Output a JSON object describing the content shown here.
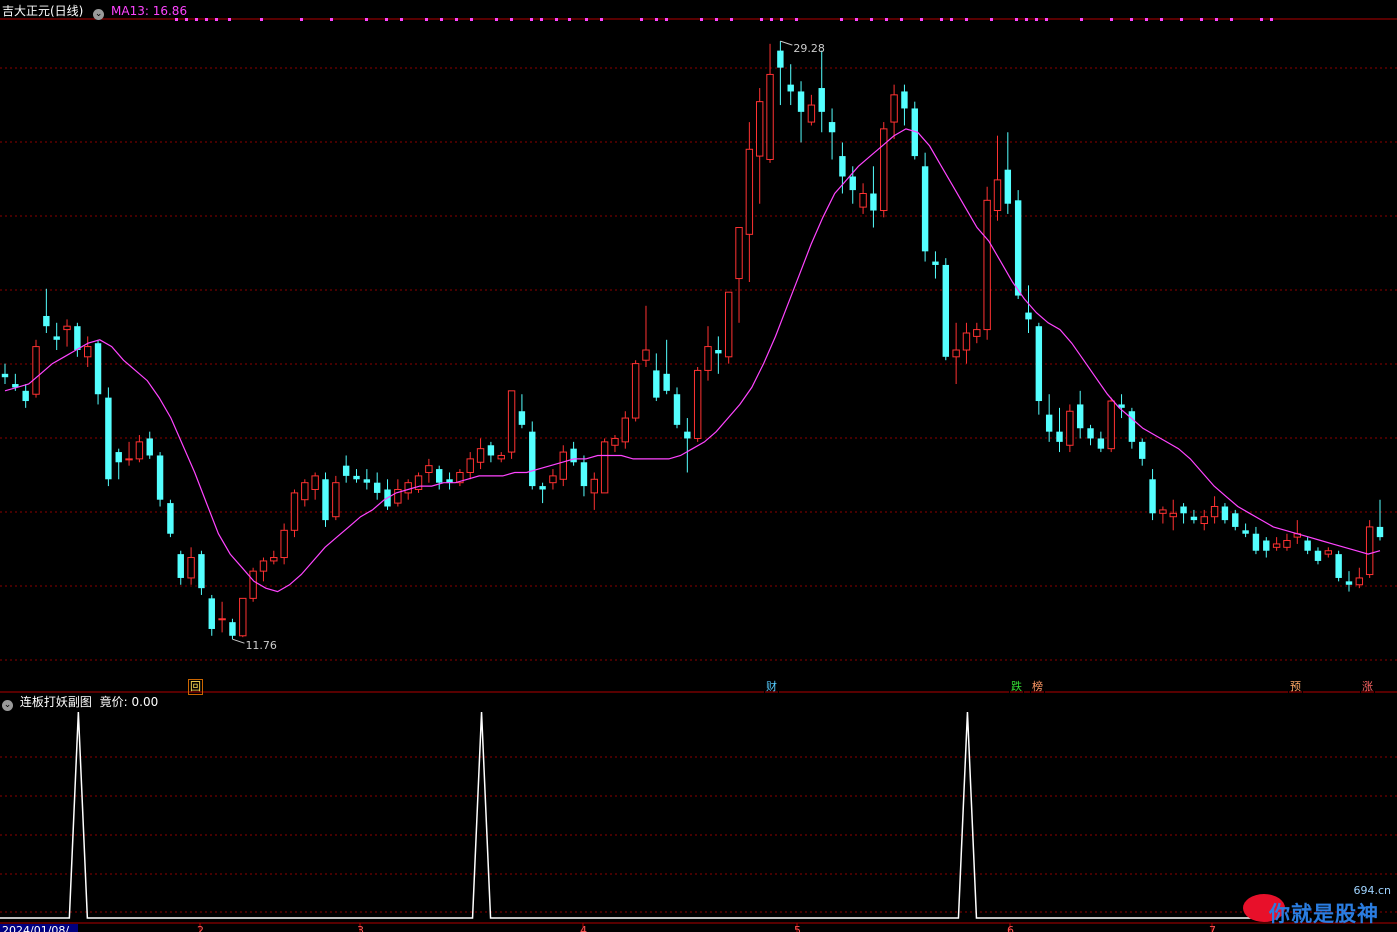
{
  "main_panel": {
    "title": "吉大正元(日线)",
    "ma_label": "MA13: 16.86",
    "high_label": "29.28",
    "low_label": "11.76"
  },
  "markers": [
    {
      "text": "回",
      "color": "#ffdd55",
      "border": "#cc6600"
    },
    {
      "text": "财",
      "color": "#55ccff",
      "border": "#000000"
    },
    {
      "text": "跌",
      "color": "#33dd33",
      "border": "#000000"
    },
    {
      "text": "榜",
      "color": "#ff9966",
      "border": "#000000"
    },
    {
      "text": "预",
      "color": "#ffaa66",
      "border": "#000000"
    },
    {
      "text": "涨",
      "color": "#ff6666",
      "border": "#000000"
    }
  ],
  "sub_panel": {
    "title": "连板打妖副图",
    "value_label": "竟价: 0.00"
  },
  "x_axis": {
    "first_date": "2024/01/08/",
    "month_ticks": [
      "2",
      "3",
      "4",
      "5",
      "6",
      "7"
    ]
  },
  "watermark": {
    "text": "你就是股神",
    "site": "694.cn"
  },
  "colors": {
    "up": "#ff3232",
    "down": "#54ffff",
    "ma": "#ff44ff",
    "grid": "#8b0000",
    "signal": "#ffffff",
    "top_dots": "#ff44ff"
  },
  "chart_data": [
    {
      "type": "candlestick",
      "title": "吉大正元(日线)",
      "series_ma": {
        "name": "MA13",
        "last": 16.86
      },
      "ylim": [
        11.0,
        29.9
      ],
      "max_label": 29.28,
      "min_label": 11.76,
      "candles_ohlc": [
        [
          19.5,
          19.8,
          19.2,
          19.4
        ],
        [
          19.2,
          19.5,
          19.0,
          19.1
        ],
        [
          19.0,
          19.2,
          18.5,
          18.7
        ],
        [
          18.9,
          20.5,
          18.8,
          20.3
        ],
        [
          21.2,
          22.0,
          20.7,
          20.9
        ],
        [
          20.6,
          21.0,
          20.2,
          20.5
        ],
        [
          20.8,
          21.1,
          20.3,
          20.9
        ],
        [
          20.9,
          21.0,
          20.0,
          20.2
        ],
        [
          20.0,
          20.6,
          19.7,
          20.3
        ],
        [
          20.4,
          20.5,
          18.6,
          18.9
        ],
        [
          18.8,
          19.1,
          16.2,
          16.4
        ],
        [
          17.2,
          17.3,
          16.4,
          16.9
        ],
        [
          17.0,
          17.5,
          16.8,
          17.0
        ],
        [
          17.0,
          17.7,
          16.9,
          17.5
        ],
        [
          17.6,
          17.8,
          17.0,
          17.1
        ],
        [
          17.1,
          17.2,
          15.6,
          15.8
        ],
        [
          15.7,
          15.8,
          14.7,
          14.8
        ],
        [
          14.2,
          14.3,
          13.3,
          13.5
        ],
        [
          13.5,
          14.4,
          13.3,
          14.1
        ],
        [
          14.2,
          14.3,
          13.0,
          13.2
        ],
        [
          12.9,
          13.0,
          11.8,
          12.0
        ],
        [
          12.3,
          12.8,
          11.9,
          12.3
        ],
        [
          12.2,
          12.3,
          11.7,
          11.8
        ],
        [
          11.8,
          12.9,
          11.76,
          12.9
        ],
        [
          12.9,
          13.8,
          12.8,
          13.7
        ],
        [
          13.7,
          14.1,
          13.4,
          14.0
        ],
        [
          14.0,
          14.3,
          13.9,
          14.1
        ],
        [
          14.1,
          15.1,
          13.9,
          14.9
        ],
        [
          14.9,
          16.1,
          14.7,
          16.0
        ],
        [
          15.8,
          16.4,
          15.6,
          16.3
        ],
        [
          16.1,
          16.6,
          15.8,
          16.5
        ],
        [
          16.4,
          16.6,
          15.0,
          15.2
        ],
        [
          15.3,
          16.5,
          15.2,
          16.3
        ],
        [
          16.8,
          17.1,
          16.3,
          16.5
        ],
        [
          16.5,
          16.7,
          16.3,
          16.4
        ],
        [
          16.4,
          16.7,
          16.1,
          16.3
        ],
        [
          16.3,
          16.6,
          15.8,
          16.0
        ],
        [
          16.1,
          16.4,
          15.5,
          15.6
        ],
        [
          15.7,
          16.4,
          15.6,
          16.1
        ],
        [
          16.0,
          16.4,
          15.8,
          16.3
        ],
        [
          16.1,
          16.6,
          16.0,
          16.5
        ],
        [
          16.6,
          17.0,
          16.3,
          16.8
        ],
        [
          16.7,
          16.8,
          16.1,
          16.3
        ],
        [
          16.4,
          16.6,
          16.1,
          16.3
        ],
        [
          16.3,
          16.7,
          16.2,
          16.6
        ],
        [
          16.6,
          17.2,
          16.4,
          17.0
        ],
        [
          16.9,
          17.6,
          16.7,
          17.3
        ],
        [
          17.4,
          17.5,
          16.9,
          17.1
        ],
        [
          17.0,
          17.2,
          16.9,
          17.1
        ],
        [
          17.2,
          19.0,
          17.0,
          19.0
        ],
        [
          18.4,
          18.9,
          17.9,
          18.0
        ],
        [
          17.8,
          18.1,
          16.1,
          16.2
        ],
        [
          16.2,
          16.3,
          15.7,
          16.1
        ],
        [
          16.3,
          16.7,
          16.1,
          16.5
        ],
        [
          16.4,
          17.4,
          16.2,
          17.2
        ],
        [
          17.3,
          17.5,
          16.8,
          16.9
        ],
        [
          16.9,
          17.1,
          15.9,
          16.2
        ],
        [
          16.0,
          16.6,
          15.5,
          16.4
        ],
        [
          16.0,
          17.6,
          16.0,
          17.5
        ],
        [
          17.4,
          17.7,
          17.2,
          17.6
        ],
        [
          17.5,
          18.4,
          17.3,
          18.2
        ],
        [
          18.2,
          19.9,
          18.1,
          19.8
        ],
        [
          19.9,
          21.5,
          19.7,
          20.2
        ],
        [
          19.6,
          20.1,
          18.7,
          18.8
        ],
        [
          19.5,
          20.5,
          18.9,
          19.0
        ],
        [
          18.9,
          19.1,
          17.9,
          18.0
        ],
        [
          17.8,
          18.2,
          16.6,
          17.6
        ],
        [
          17.6,
          19.7,
          17.5,
          19.6
        ],
        [
          19.6,
          20.9,
          19.3,
          20.3
        ],
        [
          20.2,
          20.6,
          19.5,
          20.1
        ],
        [
          20.0,
          21.9,
          19.8,
          21.9
        ],
        [
          22.3,
          23.8,
          21.0,
          23.8
        ],
        [
          23.6,
          26.9,
          22.2,
          26.1
        ],
        [
          25.9,
          27.9,
          24.5,
          27.5
        ],
        [
          25.8,
          29.2,
          25.7,
          28.3
        ],
        [
          29.0,
          29.28,
          27.4,
          28.5
        ],
        [
          28.0,
          28.6,
          27.4,
          27.8
        ],
        [
          27.8,
          28.1,
          26.3,
          27.2
        ],
        [
          26.9,
          27.7,
          26.8,
          27.4
        ],
        [
          27.9,
          29.0,
          26.6,
          27.2
        ],
        [
          26.9,
          27.3,
          25.8,
          26.6
        ],
        [
          25.9,
          26.3,
          24.8,
          25.3
        ],
        [
          25.3,
          25.6,
          24.5,
          24.9
        ],
        [
          24.4,
          25.1,
          24.2,
          24.8
        ],
        [
          24.8,
          25.6,
          23.8,
          24.3
        ],
        [
          24.3,
          26.9,
          24.1,
          26.7
        ],
        [
          26.9,
          28.0,
          26.4,
          27.7
        ],
        [
          27.8,
          28.0,
          26.8,
          27.3
        ],
        [
          27.3,
          27.5,
          25.8,
          25.9
        ],
        [
          25.6,
          26.0,
          22.8,
          23.1
        ],
        [
          22.8,
          23.1,
          22.3,
          22.7
        ],
        [
          22.7,
          22.9,
          19.9,
          20.0
        ],
        [
          20.0,
          21.0,
          19.2,
          20.2
        ],
        [
          20.2,
          21.0,
          19.8,
          20.7
        ],
        [
          20.6,
          21.0,
          20.4,
          20.8
        ],
        [
          20.8,
          25.0,
          20.5,
          24.6
        ],
        [
          24.3,
          26.5,
          24.0,
          25.2
        ],
        [
          25.5,
          26.6,
          24.2,
          24.5
        ],
        [
          24.6,
          24.9,
          21.7,
          21.8
        ],
        [
          21.3,
          22.1,
          20.7,
          21.1
        ],
        [
          20.9,
          21.0,
          18.3,
          18.7
        ],
        [
          18.3,
          18.9,
          17.5,
          17.8
        ],
        [
          17.8,
          18.5,
          17.2,
          17.5
        ],
        [
          17.4,
          18.6,
          17.2,
          18.4
        ],
        [
          18.6,
          19.0,
          17.6,
          17.9
        ],
        [
          17.9,
          18.0,
          17.4,
          17.6
        ],
        [
          17.6,
          17.8,
          17.2,
          17.3
        ],
        [
          17.3,
          18.8,
          17.2,
          18.7
        ],
        [
          18.6,
          18.9,
          18.2,
          18.5
        ],
        [
          18.4,
          18.5,
          17.3,
          17.5
        ],
        [
          17.5,
          17.6,
          16.8,
          17.0
        ],
        [
          16.4,
          16.7,
          15.2,
          15.4
        ],
        [
          15.4,
          15.6,
          15.1,
          15.5
        ],
        [
          15.3,
          15.8,
          14.9,
          15.4
        ],
        [
          15.6,
          15.7,
          15.1,
          15.4
        ],
        [
          15.3,
          15.5,
          15.1,
          15.2
        ],
        [
          15.1,
          15.5,
          14.9,
          15.3
        ],
        [
          15.3,
          15.9,
          15.1,
          15.6
        ],
        [
          15.6,
          15.7,
          15.1,
          15.2
        ],
        [
          15.4,
          15.5,
          14.9,
          15.0
        ],
        [
          14.9,
          15.1,
          14.7,
          14.8
        ],
        [
          14.8,
          15.0,
          14.2,
          14.3
        ],
        [
          14.6,
          14.7,
          14.1,
          14.3
        ],
        [
          14.4,
          14.7,
          14.3,
          14.5
        ],
        [
          14.4,
          14.8,
          14.3,
          14.6
        ],
        [
          14.7,
          15.2,
          14.5,
          14.8
        ],
        [
          14.6,
          14.7,
          14.2,
          14.3
        ],
        [
          14.3,
          14.4,
          13.9,
          14.0
        ],
        [
          14.2,
          14.4,
          14.1,
          14.3
        ],
        [
          14.2,
          14.3,
          13.4,
          13.5
        ],
        [
          13.4,
          13.7,
          13.1,
          13.3
        ],
        [
          13.3,
          13.8,
          13.2,
          13.5
        ],
        [
          13.6,
          15.2,
          13.5,
          15.0
        ],
        [
          15.0,
          15.8,
          14.6,
          14.7
        ]
      ],
      "ma13": [
        19.0,
        19.1,
        19.2,
        19.5,
        19.8,
        20.0,
        20.2,
        20.4,
        20.5,
        20.3,
        19.9,
        19.6,
        19.3,
        18.8,
        18.2,
        17.4,
        16.6,
        15.7,
        14.8,
        14.2,
        13.8,
        13.4,
        13.2,
        13.1,
        13.3,
        13.6,
        14.0,
        14.4,
        14.7,
        15.0,
        15.3,
        15.5,
        15.8,
        16.0,
        16.1,
        16.2,
        16.2,
        16.3,
        16.3,
        16.4,
        16.5,
        16.5,
        16.5,
        16.6,
        16.6,
        16.7,
        16.8,
        16.9,
        17.0,
        17.0,
        17.1,
        17.1,
        17.1,
        17.0,
        17.0,
        17.0,
        17.0,
        17.1,
        17.3,
        17.5,
        17.8,
        18.2,
        18.6,
        19.1,
        19.8,
        20.6,
        21.5,
        22.4,
        23.3,
        24.1,
        24.8,
        25.2,
        25.6,
        25.9,
        26.2,
        26.5,
        26.7,
        26.6,
        26.2,
        25.6,
        25.0,
        24.4,
        23.8,
        23.4,
        22.8,
        22.2,
        21.7,
        21.3,
        21.0,
        20.8,
        20.4,
        19.9,
        19.4,
        18.9,
        18.5,
        18.2,
        17.9,
        17.7,
        17.5,
        17.3,
        17.0,
        16.6,
        16.2,
        15.9,
        15.6,
        15.4,
        15.2,
        15.0,
        14.9,
        14.8,
        14.7,
        14.6,
        14.5,
        14.4,
        14.3,
        14.2,
        14.3
      ]
    },
    {
      "type": "line",
      "title": "连板打妖副图",
      "value_label": "竟价: 0.00",
      "ylim": [
        0,
        1
      ],
      "spike_indices": [
        4,
        43,
        90
      ]
    }
  ]
}
